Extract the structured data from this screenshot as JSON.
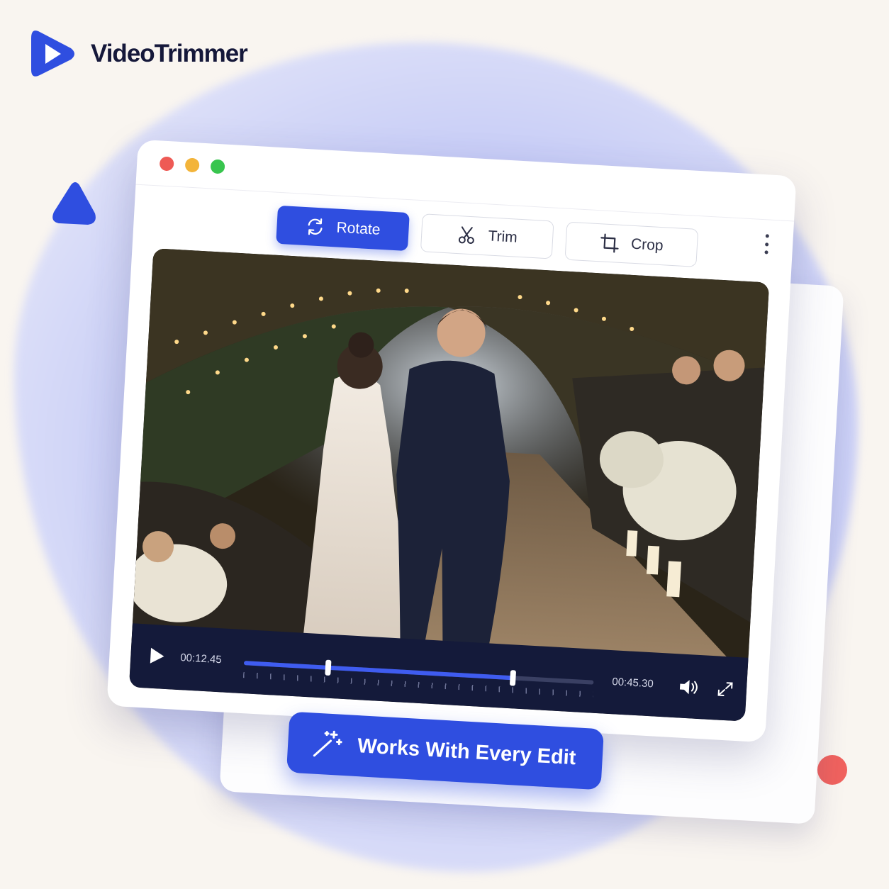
{
  "brand": {
    "name": "VideoTrimmer",
    "accent_color": "#2f4ee0"
  },
  "toolbar": {
    "buttons": [
      {
        "label": "Rotate",
        "icon": "rotate-icon",
        "active": true
      },
      {
        "label": "Trim",
        "icon": "scissors-icon",
        "active": false
      },
      {
        "label": "Crop",
        "icon": "crop-icon",
        "active": false
      }
    ]
  },
  "player": {
    "current_time": "00:12.45",
    "total_time": "00:45.30",
    "trim_start_fraction": 0.24,
    "trim_end_fraction": 0.77
  },
  "badge": {
    "text": "Works With Every Edit",
    "icon": "magic-wand-icon"
  }
}
